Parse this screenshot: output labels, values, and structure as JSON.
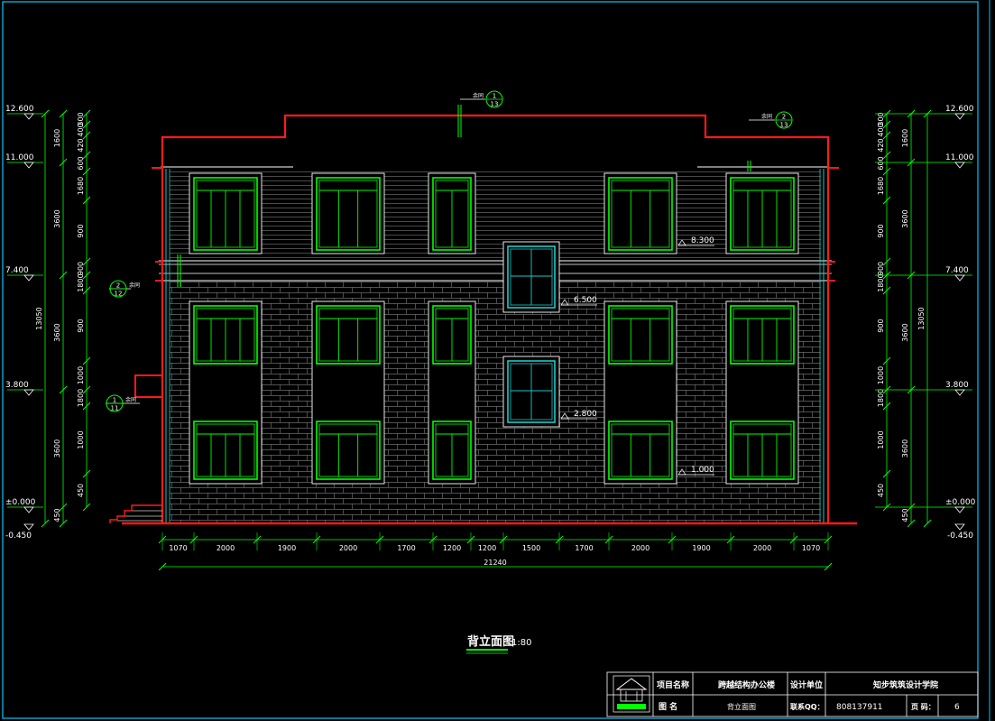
{
  "title_block": {
    "project_name_label": "项目名称",
    "project_name": "跨越结构办公楼",
    "design_unit_label": "设计单位",
    "design_unit": "知步筑筑设计学院",
    "drawing_name_label": "图 名",
    "drawing_name": "背立面图",
    "contact_label": "联系QQ：",
    "contact_value": "808137911",
    "page_label": "页 码：",
    "page_value": "6"
  },
  "drawing_title": {
    "name": "背立面图",
    "scale": "1:80"
  },
  "elevations": {
    "top": "12.600",
    "eave": "11.000",
    "second_floor": "7.400",
    "first_floor": "3.800",
    "ground": "±0.000",
    "grade": "-0.450",
    "upper_window_head": "8.300",
    "stair_window_2": "6.500",
    "stair_window_1": "2.800",
    "sill": "1.000"
  },
  "left_dims_inner": [
    "300",
    "400",
    "420",
    "600",
    "1680",
    "900",
    "900",
    "1800",
    "900",
    "1000",
    "1800",
    "1000",
    "450"
  ],
  "left_dims_outer": [
    "1600",
    "3600",
    "3600",
    "3600",
    "450"
  ],
  "total_height": "13050",
  "bottom_dims": [
    "1070",
    "2000",
    "1900",
    "2000",
    "1700",
    "1200",
    "1200",
    "1500",
    "1700",
    "2000",
    "1900",
    "2000",
    "1070"
  ],
  "total_width": "21240",
  "callouts": [
    {
      "text": "余同",
      "num": "1",
      "sheet": "13"
    },
    {
      "text": "余同",
      "num": "2",
      "sheet": "13"
    },
    {
      "text": "余同",
      "num": "2",
      "sheet": "12"
    },
    {
      "text": "余同",
      "num": "1",
      "sheet": "11"
    }
  ],
  "colors": {
    "background": "#000000",
    "frame": "#00c8ff",
    "outline": "#ff1a1a",
    "window": "#00ff00",
    "stair_window": "#1ec8c8",
    "dim": "#00ff00",
    "text": "#ffffff"
  }
}
